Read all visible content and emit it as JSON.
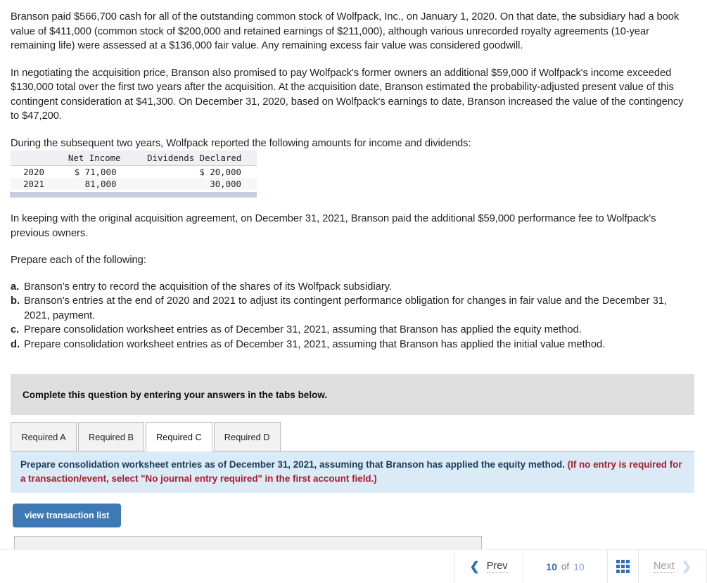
{
  "problem": {
    "paragraphs": [
      "Branson paid $566,700 cash for all of the outstanding common stock of Wolfpack, Inc., on January 1, 2020. On that date, the subsidiary had a book value of $411,000 (common stock of $200,000 and retained earnings of $211,000), although various unrecorded royalty agreements (10-year remaining life) were assessed at a $136,000 fair value. Any remaining excess fair value was considered goodwill.",
      "In negotiating the acquisition price, Branson also promised to pay Wolfpack's former owners an additional $59,000 if Wolfpack's income exceeded $130,000 total over the first two years after the acquisition. At the acquisition date, Branson estimated the probability-adjusted present value of this contingent consideration at $41,300. On December 31, 2020, based on Wolfpack's earnings to date, Branson increased the value of the contingency to $47,200.",
      "During the subsequent two years, Wolfpack reported the following amounts for income and dividends:",
      "In keeping with the original acquisition agreement, on December 31, 2021, Branson paid the additional $59,000 performance fee to Wolfpack's previous owners.",
      "Prepare each of the following:"
    ]
  },
  "data_table": {
    "columns": [
      "",
      "Net Income",
      "Dividends Declared"
    ],
    "rows": [
      {
        "year": "2020",
        "net_income": "$ 71,000",
        "dividends": "$ 20,000"
      },
      {
        "year": "2021",
        "net_income": "81,000",
        "dividends": "30,000"
      }
    ]
  },
  "requirements": [
    {
      "marker": "a.",
      "text": "Branson's entry to record the acquisition of the shares of its Wolfpack subsidiary."
    },
    {
      "marker": "b.",
      "text": "Branson's entries at the end of 2020 and 2021 to adjust its contingent performance obligation for changes in fair value and the December 31, 2021, payment."
    },
    {
      "marker": "c.",
      "text": "Prepare consolidation worksheet entries as of December 31, 2021, assuming that Branson has applied the equity method."
    },
    {
      "marker": "d.",
      "text": "Prepare consolidation worksheet entries as of December 31, 2021, assuming that Branson has applied the initial value method."
    }
  ],
  "answer_area": {
    "banner": "Complete this question by entering your answers in the tabs below.",
    "tabs": [
      {
        "label": "Required A",
        "active": false
      },
      {
        "label": "Required B",
        "active": false
      },
      {
        "label": "Required C",
        "active": true
      },
      {
        "label": "Required D",
        "active": false
      }
    ],
    "instruction_main": "Prepare consolidation worksheet entries as of December 31, 2021, assuming that Branson has applied the equity method. ",
    "instruction_note": "(If no entry is required for a transaction/event, select \"No journal entry required\" in the first account field.)",
    "action_button": "view transaction list"
  },
  "footer": {
    "prev_label": "Prev",
    "next_label": "Next",
    "current_page": "10",
    "of_label": "of",
    "total_pages": "10",
    "grid_icon": "grid-view-icon"
  },
  "colors": {
    "accent_blue": "#3c79b5",
    "link_blue": "#2f6dbb",
    "note_red": "#a61f2b",
    "banner_gray": "#dedede",
    "info_blue": "#dbeaf7"
  }
}
